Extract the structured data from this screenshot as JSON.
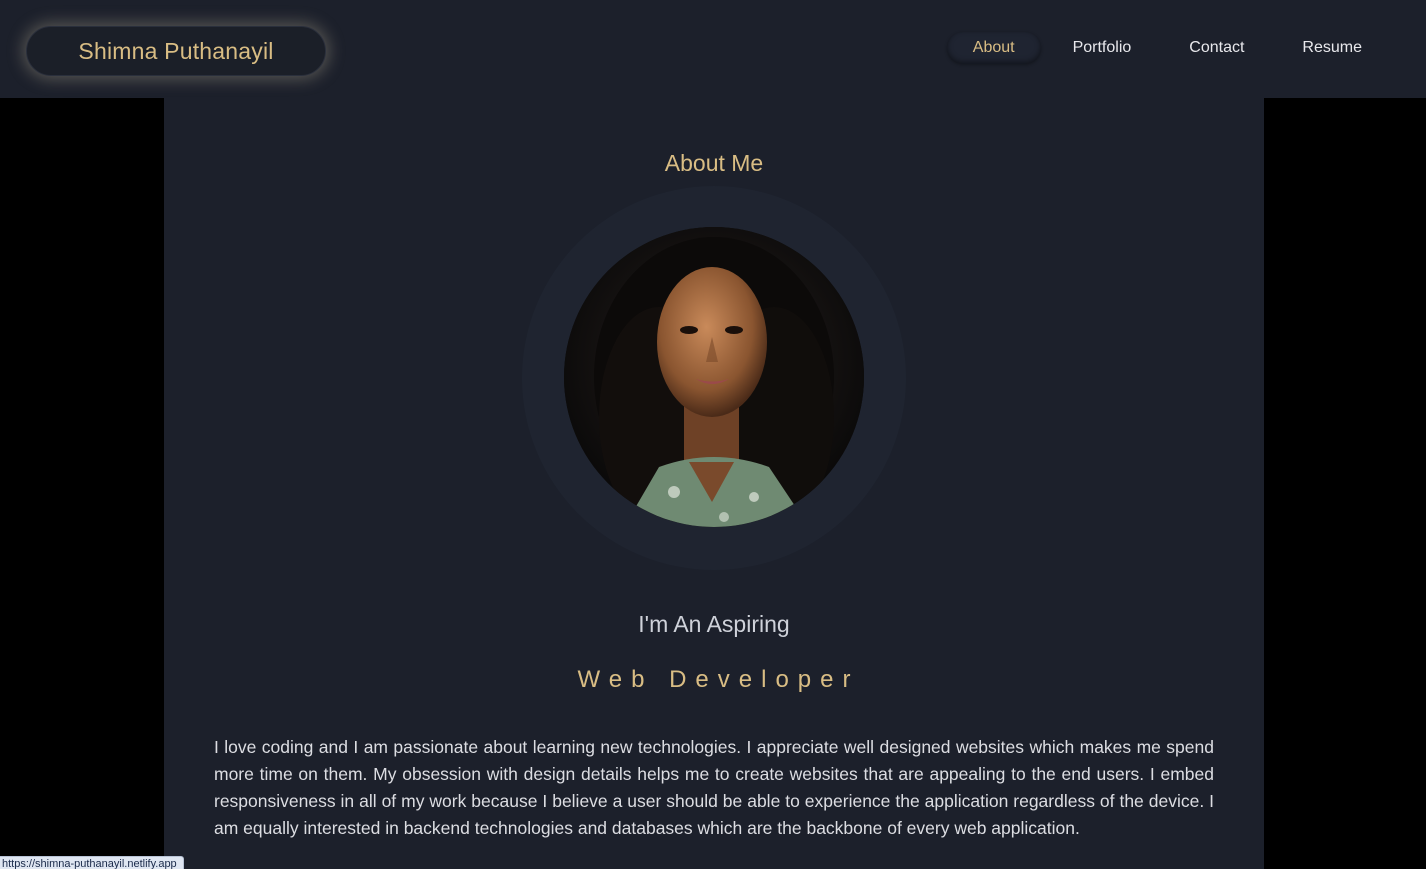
{
  "header": {
    "brand": "Shimna Puthanayil",
    "nav": [
      {
        "label": "About",
        "active": true
      },
      {
        "label": "Portfolio",
        "active": false
      },
      {
        "label": "Contact",
        "active": false
      },
      {
        "label": "Resume",
        "active": false
      }
    ]
  },
  "about": {
    "title": "About Me",
    "photo_icon": "profile-photo",
    "aspiring": "I'm An Aspiring",
    "role": "Web Developer",
    "bio": "I love coding and I am passionate about learning new technologies. I appreciate well designed websites which makes me spend more time on them. My obsession with design details helps me to create websites that are appealing to the end users. I embed responsiveness in all of my work because I believe a user should be able to experience the application regardless of the device. I am equally interested in backend technologies and databases which are the backbone of every web application."
  },
  "status_bar": {
    "url": "https://shimna-puthanayil.netlify.app"
  },
  "colors": {
    "accent": "#d9bd84",
    "background": "#1c202b",
    "page_bg": "#000000",
    "text": "#dcdde2"
  }
}
